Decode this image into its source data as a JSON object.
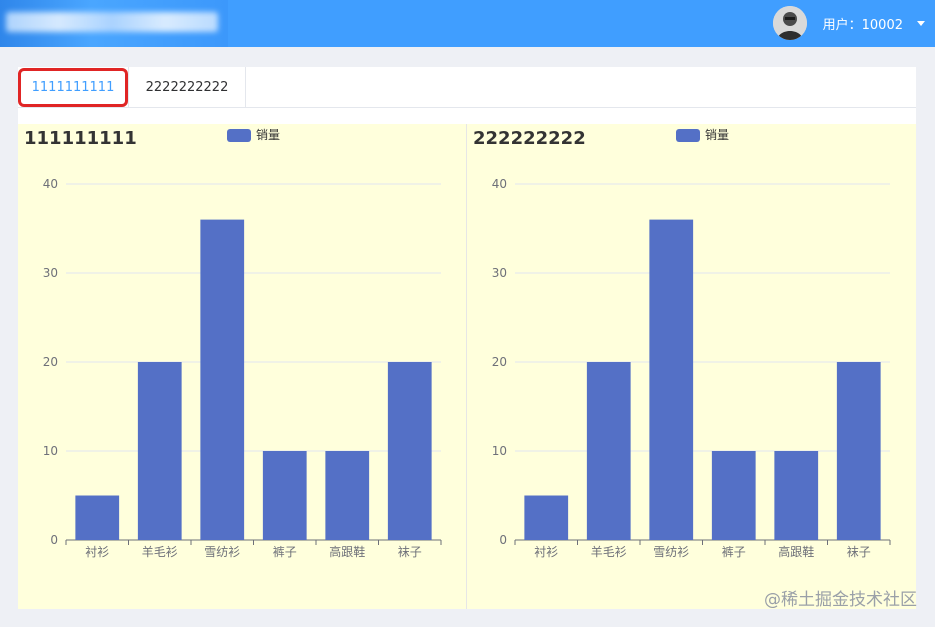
{
  "header": {
    "user_label": "用户：10002"
  },
  "tabs": [
    {
      "label": "1111111111"
    },
    {
      "label": "2222222222"
    }
  ],
  "watermark": "@稀土掘金技术社区",
  "colors": {
    "bar": "#5470c6",
    "panel_bg": "#ffffdc",
    "header": "#409eff",
    "active_tab": "#409eff"
  },
  "chart_data": [
    {
      "type": "bar",
      "title": "111111111",
      "legend": [
        "销量"
      ],
      "categories": [
        "衬衫",
        "羊毛衫",
        "雪纺衫",
        "裤子",
        "高跟鞋",
        "袜子"
      ],
      "series": [
        {
          "name": "销量",
          "values": [
            5,
            20,
            36,
            10,
            10,
            20
          ]
        }
      ],
      "ylim": [
        0,
        40
      ],
      "yticks": [
        0,
        10,
        20,
        30,
        40
      ],
      "grid": true,
      "legend_position": "top-center"
    },
    {
      "type": "bar",
      "title": "222222222",
      "legend": [
        "销量"
      ],
      "categories": [
        "衬衫",
        "羊毛衫",
        "雪纺衫",
        "裤子",
        "高跟鞋",
        "袜子"
      ],
      "series": [
        {
          "name": "销量",
          "values": [
            5,
            20,
            36,
            10,
            10,
            20
          ]
        }
      ],
      "ylim": [
        0,
        40
      ],
      "yticks": [
        0,
        10,
        20,
        30,
        40
      ],
      "grid": true,
      "legend_position": "top-center"
    }
  ]
}
